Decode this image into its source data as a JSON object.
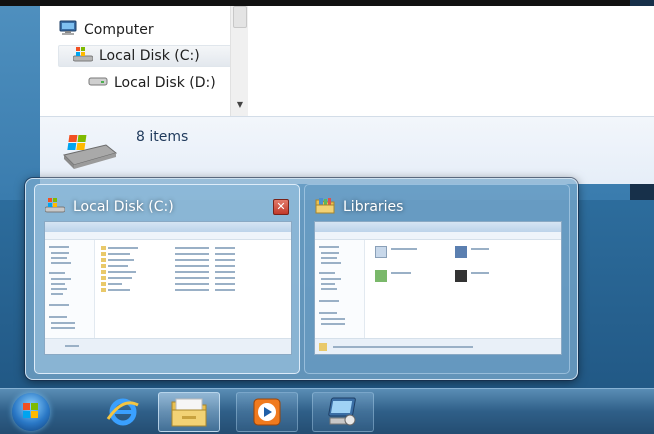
{
  "explorer": {
    "nav_items": [
      {
        "label": "Computer",
        "icon": "computer-icon"
      },
      {
        "label": "Local Disk (C:)",
        "icon": "windows-drive-icon",
        "selected": true
      },
      {
        "label": "Local Disk (D:)",
        "icon": "drive-icon"
      }
    ],
    "item_count": "8 items",
    "details_icon": "drive-large-icon"
  },
  "thumbnails": [
    {
      "title": "Local Disk (C:)",
      "icon": "windows-drive-icon",
      "active": true,
      "close_label": "✕"
    },
    {
      "title": "Libraries",
      "icon": "libraries-folder-icon",
      "active": false
    }
  ],
  "taskbar": {
    "buttons": [
      {
        "name": "start-button",
        "icon": "windows-logo-icon"
      },
      {
        "name": "taskbar-internet-explorer",
        "icon": "internet-explorer-icon"
      },
      {
        "name": "taskbar-windows-explorer",
        "icon": "folder-icon",
        "active": true
      },
      {
        "name": "taskbar-media-player",
        "icon": "media-player-icon"
      },
      {
        "name": "taskbar-remote-desktop",
        "icon": "remote-desktop-icon"
      }
    ]
  },
  "colors": {
    "close": "#c23a2a",
    "taskbar": "#2f5f88",
    "desktop": "#2d6d9d"
  }
}
